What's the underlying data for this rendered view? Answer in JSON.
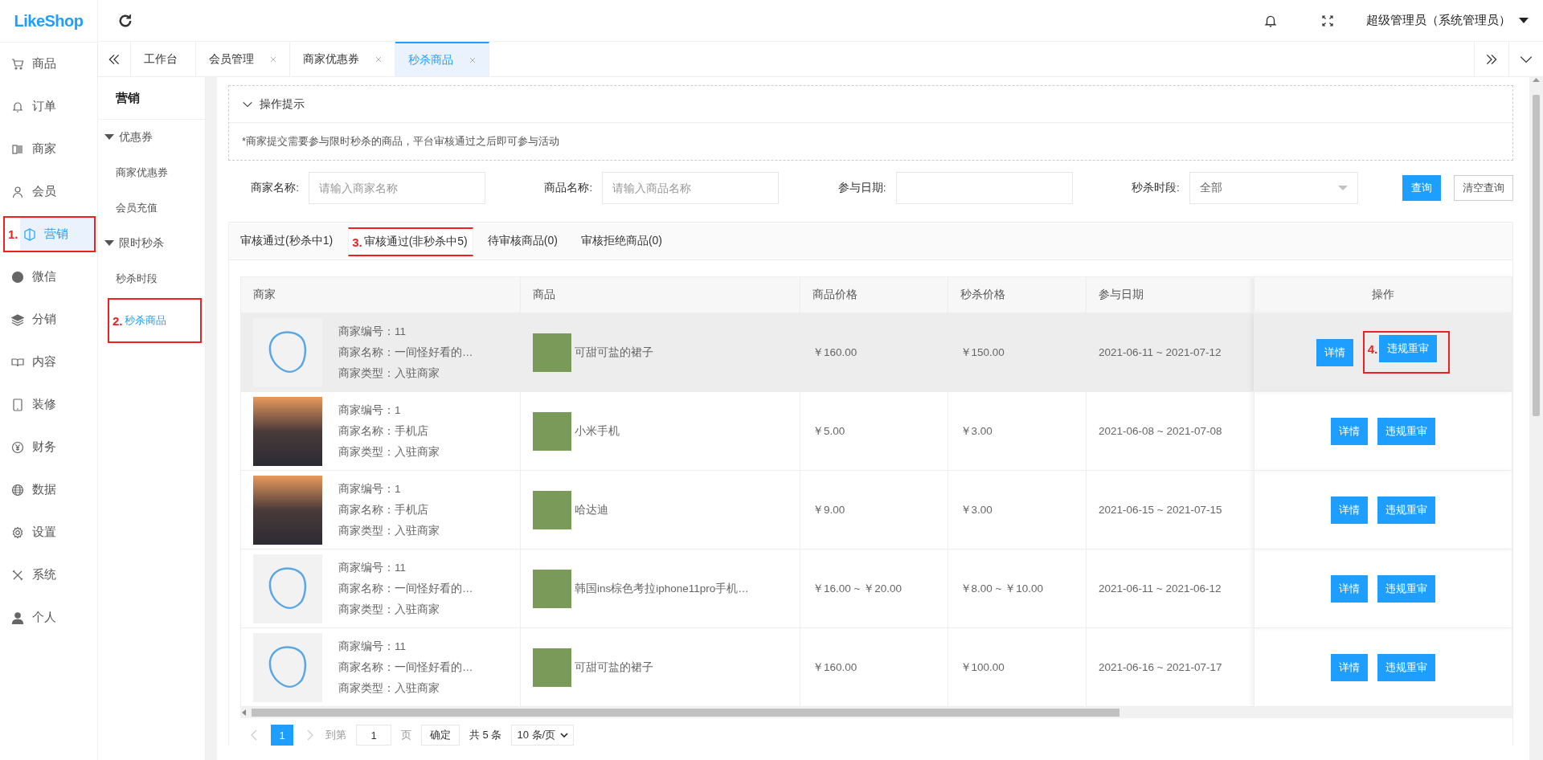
{
  "brand": {
    "logo": "LikeShop"
  },
  "header": {
    "user": "超级管理员（系统管理员）"
  },
  "sidebar": {
    "items": [
      {
        "label": "商品",
        "selected": false
      },
      {
        "label": "订单",
        "selected": false
      },
      {
        "label": "商家",
        "selected": false
      },
      {
        "label": "会员",
        "selected": false
      },
      {
        "label": "营销",
        "selected": true,
        "annotation": "1."
      },
      {
        "label": "微信",
        "selected": false
      },
      {
        "label": "分销",
        "selected": false
      },
      {
        "label": "内容",
        "selected": false
      },
      {
        "label": "装修",
        "selected": false
      },
      {
        "label": "财务",
        "selected": false
      },
      {
        "label": "数据",
        "selected": false
      },
      {
        "label": "设置",
        "selected": false
      },
      {
        "label": "系统",
        "selected": false
      },
      {
        "label": "个人",
        "selected": false
      }
    ]
  },
  "page_tabs": [
    {
      "label": "工作台",
      "selected": false,
      "closable": false
    },
    {
      "label": "会员管理",
      "selected": false,
      "closable": true
    },
    {
      "label": "商家优惠券",
      "selected": false,
      "closable": true
    },
    {
      "label": "秒杀商品",
      "selected": true,
      "closable": true
    }
  ],
  "subnav": {
    "title": "营销",
    "groups": [
      {
        "label": "优惠券",
        "expanded": true,
        "children": [
          {
            "label": "商家优惠券",
            "selected": false
          },
          {
            "label": "会员充值",
            "selected": false
          }
        ]
      },
      {
        "label": "限时秒杀",
        "expanded": true,
        "children": [
          {
            "label": "秒杀时段",
            "selected": false
          },
          {
            "label": "秒杀商品",
            "selected": true,
            "annotation": "2."
          }
        ]
      }
    ]
  },
  "tips": {
    "title": "操作提示",
    "expanded": true,
    "text": "*商家提交需要参与限时秒杀的商品，平台审核通过之后即可参与活动"
  },
  "filters": [
    {
      "kind": "input",
      "label": "商家名称:",
      "placeholder": "请输入商家名称"
    },
    {
      "kind": "input",
      "label": "商品名称:",
      "placeholder": "请输入商品名称"
    },
    {
      "kind": "date",
      "label": "参与日期:"
    },
    {
      "kind": "select",
      "label": "秒杀时段:",
      "value": "全部"
    }
  ],
  "filter_buttons": [
    {
      "kind": "primary",
      "label": "查询"
    },
    {
      "kind": "plain",
      "label": "清空查询"
    }
  ],
  "status_tabs": [
    {
      "label": "审核通过(秒杀中1)",
      "selected": false
    },
    {
      "label": "审核通过(非秒杀中5)",
      "selected": true,
      "annotation": "3."
    },
    {
      "label": "待审核商品(0)",
      "selected": false
    },
    {
      "label": "审核拒绝商品(0)",
      "selected": false
    }
  ],
  "table": {
    "columns": [
      "商家",
      "商品",
      "商品价格",
      "秒杀价格",
      "参与日期",
      "操作"
    ],
    "rows": [
      {
        "hovered": true,
        "kind": "logo",
        "merchant_lines": [
          "商家编号：11",
          "商家名称：一间怪好看的…",
          "商家类型：入驻商家"
        ],
        "product": "可甜可盐的裙子",
        "price": "￥160.00",
        "flash_price": "￥150.00",
        "dates": "2021-06-11 ~ 2021-07-12",
        "actions": [
          {
            "label": "详情"
          },
          {
            "label": "违规重审",
            "annotation": "4."
          }
        ]
      },
      {
        "hovered": false,
        "kind": "photo",
        "merchant_lines": [
          "商家编号：1",
          "商家名称：手机店",
          "商家类型：入驻商家"
        ],
        "product": "小米手机",
        "price": "￥5.00",
        "flash_price": "￥3.00",
        "dates": "2021-06-08 ~ 2021-07-08",
        "actions": [
          {
            "label": "详情"
          },
          {
            "label": "违规重审"
          }
        ]
      },
      {
        "hovered": false,
        "kind": "photo",
        "merchant_lines": [
          "商家编号：1",
          "商家名称：手机店",
          "商家类型：入驻商家"
        ],
        "product": "哈达迪",
        "price": "￥9.00",
        "flash_price": "￥3.00",
        "dates": "2021-06-15 ~ 2021-07-15",
        "actions": [
          {
            "label": "详情"
          },
          {
            "label": "违规重审"
          }
        ]
      },
      {
        "hovered": false,
        "kind": "logo",
        "merchant_lines": [
          "商家编号：11",
          "商家名称：一间怪好看的…",
          "商家类型：入驻商家"
        ],
        "product": "韩国ins棕色考拉iphone11pro手机…",
        "price": "￥16.00 ~ ￥20.00",
        "flash_price": "￥8.00 ~ ￥10.00",
        "dates": "2021-06-11 ~ 2021-06-12",
        "actions": [
          {
            "label": "详情"
          },
          {
            "label": "违规重审"
          }
        ]
      },
      {
        "hovered": false,
        "kind": "logo",
        "merchant_lines": [
          "商家编号：11",
          "商家名称：一间怪好看的…",
          "商家类型：入驻商家"
        ],
        "product": "可甜可盐的裙子",
        "price": "￥160.00",
        "flash_price": "￥100.00",
        "dates": "2021-06-16 ~ 2021-07-17",
        "actions": [
          {
            "label": "详情"
          },
          {
            "label": "违规重审"
          }
        ]
      }
    ]
  },
  "pager": {
    "pages": [
      {
        "label": "1",
        "selected": true
      }
    ],
    "goto_label": "到第",
    "goto_value": "1",
    "page_unit": "页",
    "confirm": "确定",
    "total": "共 5 条",
    "page_size": "10 条/页"
  }
}
